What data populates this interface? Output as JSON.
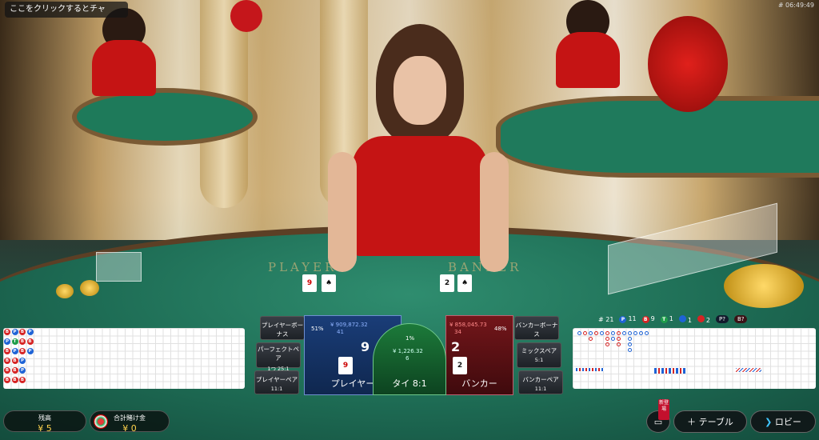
{
  "header": {
    "chat_prompt": "ここをクリックするとチャ",
    "clock": "# 06:49:49"
  },
  "table_felt": {
    "player_word": "PLAYER",
    "banker_word": "BANKER"
  },
  "stats": {
    "round": "# 21",
    "player_count": "11",
    "banker_count": "9",
    "tie_count": "1",
    "player_pair_count": "1",
    "banker_pair_count": "2",
    "player_predict": "P?",
    "banker_predict": "B?"
  },
  "side_bets": {
    "player_bonus": "プレイヤーボーナス",
    "perfect_pair": "パーフェクトペア",
    "perfect_pair_odds": "1つ 25:1",
    "player_pair": "プレイヤーペア",
    "player_pair_odds": "11:1",
    "banker_bonus": "バンカーボーナス",
    "mixed_pair": "ミックスペア",
    "mixed_pair_odds": "5:1",
    "banker_pair": "バンカーペア",
    "banker_pair_odds": "11:1"
  },
  "player": {
    "label": "プレイヤー",
    "percent": "51%",
    "total": "¥ 909,872.32",
    "players": "41",
    "score": "9",
    "card": "9"
  },
  "tie": {
    "label": "タイ 8:1",
    "percent": "1%",
    "total": "¥ 1,226.32",
    "players": "6"
  },
  "banker": {
    "label": "バンカー",
    "percent": "48%",
    "total": "¥ 858,045.73",
    "players": "34",
    "score": "2",
    "card": "2"
  },
  "bottom": {
    "balance_label": "残高",
    "balance_value": "¥ 5",
    "total_bet_label": "合計賭け金",
    "total_bet_value": "¥ 0",
    "new_badge": "新登場",
    "table_button": "テーブル",
    "lobby_button": "ロビー"
  },
  "bead_road": [
    [
      "B",
      "P",
      "B",
      "P"
    ],
    [
      "P",
      "T",
      "B",
      "B"
    ],
    [
      "B",
      "P",
      "B",
      "P"
    ],
    [
      "B",
      "B",
      "P",
      ""
    ],
    [
      "B",
      "B",
      "P",
      ""
    ],
    [
      "B",
      "B",
      "B",
      ""
    ]
  ],
  "colors": {
    "player": "#1e63d6",
    "banker": "#d62424",
    "tie": "#1f9d4a",
    "gold": "#ffd34d"
  }
}
